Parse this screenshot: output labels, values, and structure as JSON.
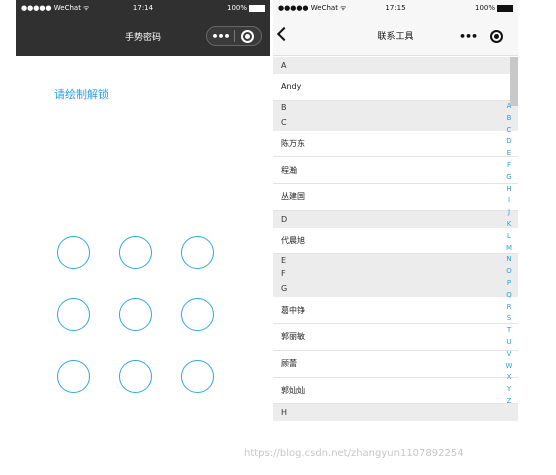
{
  "left_screen": {
    "status": {
      "carrier": "●●●●● WeChat",
      "wifi_icon": "wifi-icon",
      "time": "17:14",
      "battery": "100%"
    },
    "nav": {
      "title": "手势密码",
      "more": "•••"
    },
    "prompt": "请绘制解锁",
    "pattern_dots": 9
  },
  "right_screen": {
    "status": {
      "carrier": "●●●●● WeChat",
      "wifi_icon": "wifi-icon",
      "time": "17:15",
      "battery": "100%"
    },
    "nav": {
      "title": "联系工具",
      "more": "•••"
    },
    "groups": [
      {
        "letter": "A",
        "contacts": [
          "Andy"
        ]
      },
      {
        "letter": "B",
        "contacts": []
      },
      {
        "letter": "C",
        "contacts": [
          "陈万东",
          "程瀚",
          "丛建国"
        ]
      },
      {
        "letter": "D",
        "contacts": [
          "代晨旭"
        ]
      },
      {
        "letter": "E",
        "contacts": []
      },
      {
        "letter": "F",
        "contacts": []
      },
      {
        "letter": "G",
        "contacts": [
          "葛中铮",
          "郭丽敏",
          "顾蕾",
          "郭灿灿"
        ]
      },
      {
        "letter": "H",
        "contacts": []
      }
    ],
    "index_letters": [
      "A",
      "B",
      "C",
      "D",
      "E",
      "F",
      "G",
      "H",
      "I",
      "J",
      "K",
      "L",
      "M",
      "N",
      "O",
      "P",
      "Q",
      "R",
      "S",
      "T",
      "U",
      "V",
      "W",
      "X",
      "Y",
      "Z"
    ]
  },
  "watermark": "https://blog.csdn.net/zhangyun1107892254",
  "colors": {
    "accent": "#2d9fe3",
    "dark_nav": "#303030",
    "light_nav": "#f7f7f7",
    "section_bg": "#ececec"
  }
}
